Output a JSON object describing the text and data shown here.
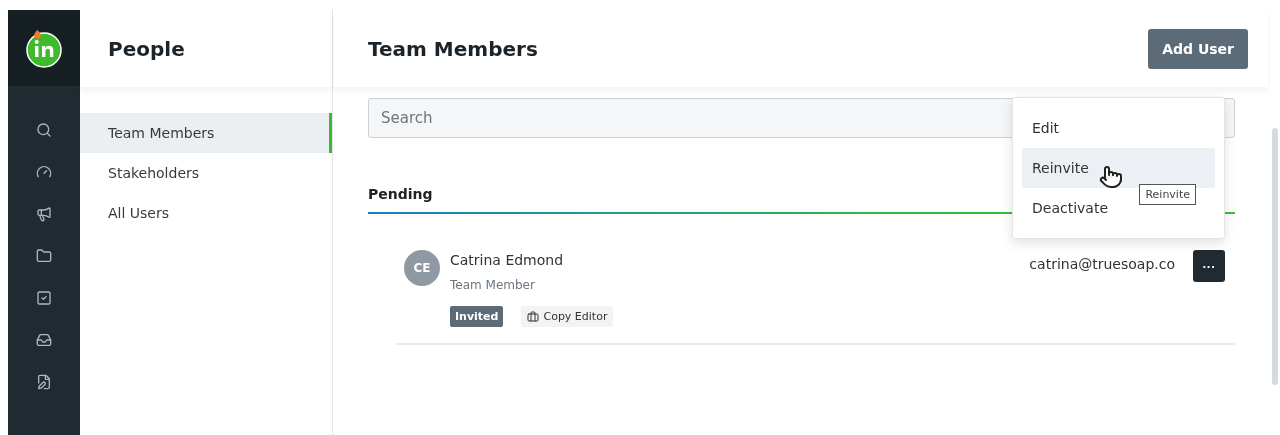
{
  "rail": {
    "items": [
      {
        "kind": "search"
      },
      {
        "kind": "dashboard"
      },
      {
        "kind": "announce"
      },
      {
        "kind": "folder"
      },
      {
        "kind": "tasks"
      },
      {
        "kind": "inbox"
      },
      {
        "kind": "docs"
      }
    ]
  },
  "sidebar": {
    "title": "People",
    "items": [
      {
        "label": "Team Members",
        "selected": true
      },
      {
        "label": "Stakeholders",
        "selected": false
      },
      {
        "label": "All Users",
        "selected": false
      }
    ]
  },
  "header": {
    "title": "Team Members",
    "button": "Add User"
  },
  "search": {
    "placeholder": "Search"
  },
  "section": {
    "title": "Pending"
  },
  "members": [
    {
      "initials": "CE",
      "name": "Catrina Edmond",
      "role": "Team Member",
      "status": "Invited",
      "tag": "Copy Editor",
      "email": "catrina@truesoap.co",
      "more": "···"
    }
  ],
  "menu": {
    "items": [
      {
        "label": "Edit",
        "selected": false
      },
      {
        "label": "Reinvite",
        "selected": true
      },
      {
        "label": "Deactivate",
        "selected": false
      }
    ],
    "tooltip": "Reinvite"
  }
}
